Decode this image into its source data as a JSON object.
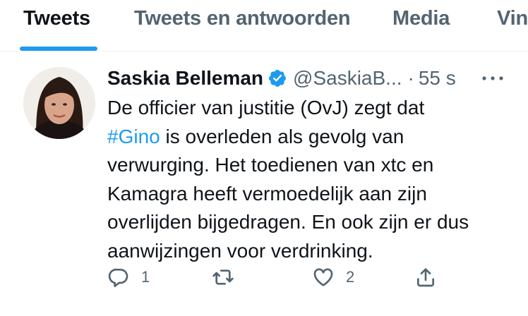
{
  "tabs": [
    {
      "label": "Tweets",
      "active": true
    },
    {
      "label": "Tweets en antwoorden",
      "active": false
    },
    {
      "label": "Media",
      "active": false
    },
    {
      "label": "Vin",
      "active": false
    }
  ],
  "tweet": {
    "author_name": "Saskia Belleman",
    "verified": true,
    "handle": "@SaskiaB...",
    "time": "55 s",
    "lines": [
      "De officier van justitie (OvJ) zegt dat",
      "is overleden als gevolg van",
      "verwurging. Het toedienen van xtc en",
      "Kamagra heeft vermoedelijk aan zijn",
      "overlijden bijgedragen. En ook zijn er dus",
      "aanwijzingen voor verdrinking."
    ],
    "hashtag": "#Gino",
    "reply_count": "1",
    "retweet_count": "",
    "like_count": "2"
  },
  "icons": {
    "verified": "verified-badge-icon",
    "more": "more-horizontal-icon",
    "reply": "reply-icon",
    "retweet": "retweet-icon",
    "like": "heart-icon",
    "share": "share-icon"
  },
  "colors": {
    "accent": "#1d9bf0",
    "text": "#0f1419",
    "secondary": "#536471"
  }
}
